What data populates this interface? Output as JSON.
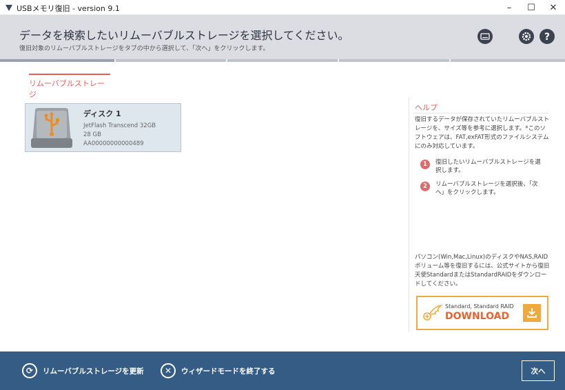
{
  "window": {
    "title": "USBメモリ復旧 - version 9.1",
    "minimize": "–",
    "maximize": "☐",
    "close": "✕"
  },
  "header": {
    "title": "データを検索したいリムーバブルストレージを選択してください。",
    "subtitle": "復旧対象のリムーバブルストレージをタブの中から選択して、「次へ」をクリックします。",
    "icons": [
      "keyboard-icon",
      "gear-icon",
      "help-icon"
    ]
  },
  "tabs": [
    {
      "label": "リムーバブルストレージ",
      "active": true
    }
  ],
  "disks": [
    {
      "name": "ディスク 1",
      "model": "JetFlash Transcend 32GB",
      "size": "28 GB",
      "serial": "AA00000000000489"
    }
  ],
  "help": {
    "title": "ヘルプ",
    "text": "復旧するデータが保存されていたリムーバブルストレージを、サイズ等を参考に選択します。*このソフトウェアは、FAT,exFAT形式のファイルシステムにのみ対応しています。",
    "steps": [
      {
        "num": "1",
        "text": "復旧したいリムーバブルストレージを選択します。"
      },
      {
        "num": "2",
        "text": "リムーバブルストレージを選択後、「次へ」をクリックします。"
      }
    ],
    "promo": "パソコン(Win,Mac,Linux)のディスクやNAS,RAIDボリューム等を復旧するには、公式サイトから復旧天使StandardまたはStandardRAIDをダウンロードしてください。",
    "download": {
      "small": "Standard, Standard RAID",
      "big": "DOWNLOAD"
    }
  },
  "footer": {
    "refresh_label": "リムーバブルストレージを更新",
    "exit_label": "ウィザードモードを終了する",
    "next_label": "次へ"
  },
  "colors": {
    "accent": "#e85c5c",
    "footer": "#355c84",
    "download": "#f2a93b"
  }
}
